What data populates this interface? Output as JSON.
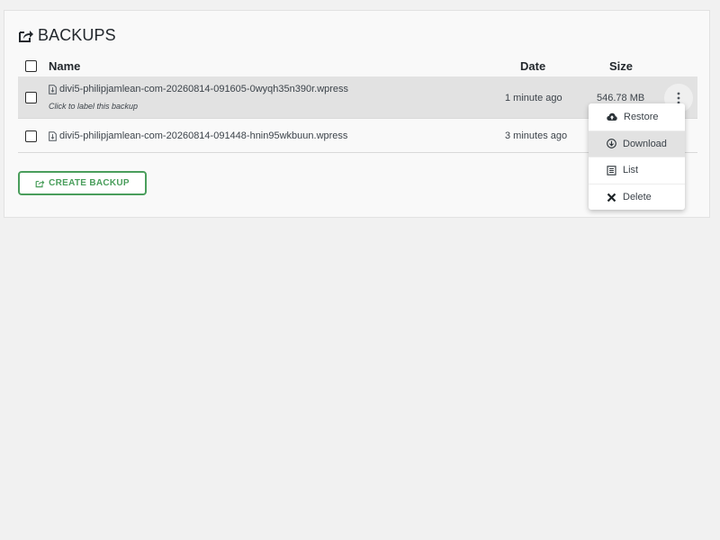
{
  "panel": {
    "title": "BACKUPS",
    "icon": "export-icon"
  },
  "table": {
    "columns": {
      "name": "Name",
      "date": "Date",
      "size": "Size"
    },
    "rows": [
      {
        "filename": "divi5-philipjamlean-com-20260814-091605-0wyqh35n390r.wpress",
        "label_hint": "Click to label this backup",
        "date": "1 minute ago",
        "size": "546.78 MB"
      },
      {
        "filename": "divi5-philipjamlean-com-20260814-091448-hnin95wkbuun.wpress",
        "date": "3 minutes ago"
      }
    ]
  },
  "create_button": {
    "label": "CREATE BACKUP"
  },
  "context_menu": {
    "items": [
      {
        "label": "Restore",
        "icon": "cloud-upload-icon"
      },
      {
        "label": "Download",
        "icon": "download-circle-icon",
        "active": true
      },
      {
        "label": "List",
        "icon": "list-icon"
      },
      {
        "label": "Delete",
        "icon": "close-icon"
      }
    ]
  },
  "colors": {
    "accent_green": "#4a9e5c",
    "row_highlight": "#e2e2e2"
  }
}
